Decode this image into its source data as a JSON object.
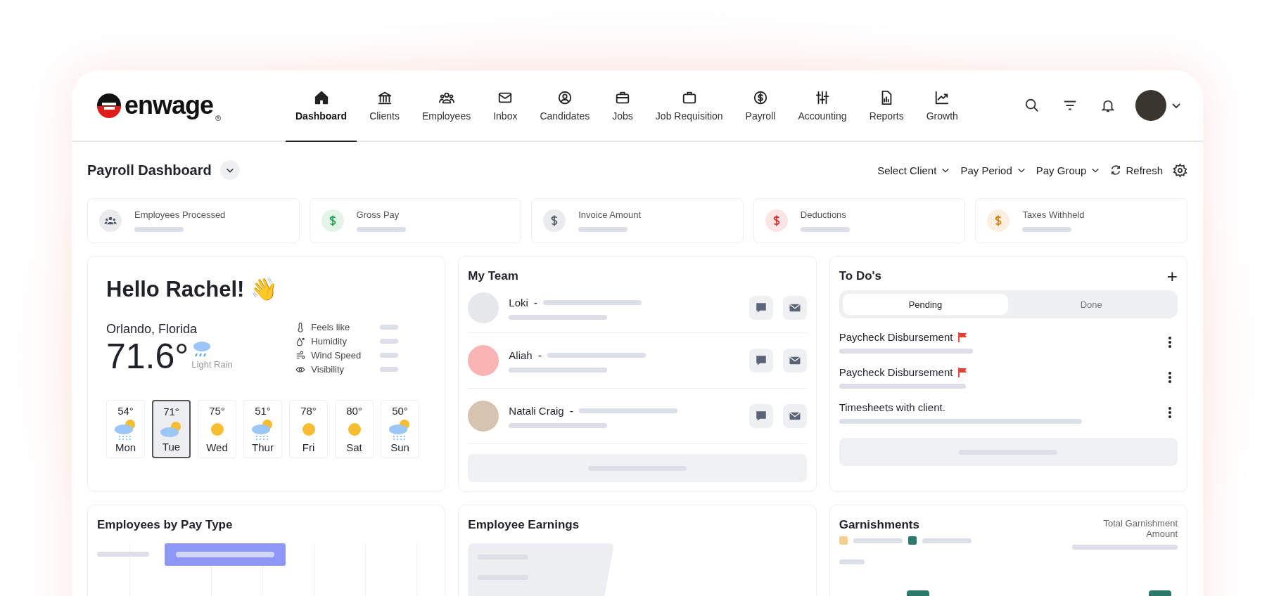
{
  "logo": {
    "text": "enwage",
    "mark": "®"
  },
  "nav": [
    {
      "label": "Dashboard",
      "selected": true
    },
    {
      "label": "Clients",
      "selected": false
    },
    {
      "label": "Employees",
      "selected": false
    },
    {
      "label": "Inbox",
      "selected": false
    },
    {
      "label": "Candidates",
      "selected": false
    },
    {
      "label": "Jobs",
      "selected": false
    },
    {
      "label": "Job Requisition",
      "selected": false
    },
    {
      "label": "Payroll",
      "selected": false
    },
    {
      "label": "Accounting",
      "selected": false
    },
    {
      "label": "Reports",
      "selected": false
    },
    {
      "label": "Growth",
      "selected": false
    }
  ],
  "page_title": "Payroll Dashboard",
  "filters": [
    "Select Client",
    "Pay Period",
    "Pay Group"
  ],
  "refresh": "Refresh",
  "kpis": [
    {
      "label": "Employees Processed",
      "kind": "people",
      "color": "#4b5563"
    },
    {
      "label": "Gross Pay",
      "kind": "dollar",
      "color": "#16a34a"
    },
    {
      "label": "Invoice Amount",
      "kind": "dollar",
      "color": "#4b5563"
    },
    {
      "label": "Deductions",
      "kind": "dollar",
      "color": "#dc2626"
    },
    {
      "label": "Taxes Withheld",
      "kind": "dollar",
      "color": "#d97706"
    }
  ],
  "weather": {
    "greeting": "Hello Rachel!",
    "emoji": "👋",
    "location": "Orlando, Florida",
    "temperature": "71.6°",
    "condition": "Light Rain",
    "details": [
      "Feels like",
      "Humidity",
      "Wind Speed",
      "Visibility"
    ],
    "forecast": [
      {
        "temp": "54°",
        "day": "Mon",
        "kind": "rain",
        "selected": false
      },
      {
        "temp": "71°",
        "day": "Tue",
        "kind": "cloudy",
        "selected": true
      },
      {
        "temp": "75°",
        "day": "Wed",
        "kind": "sunny",
        "selected": false
      },
      {
        "temp": "51°",
        "day": "Thur",
        "kind": "rain",
        "selected": false
      },
      {
        "temp": "78°",
        "day": "Fri",
        "kind": "sunny",
        "selected": false
      },
      {
        "temp": "80°",
        "day": "Sat",
        "kind": "sunny",
        "selected": false
      },
      {
        "temp": "50°",
        "day": "Sun",
        "kind": "rain",
        "selected": false
      }
    ]
  },
  "team": {
    "title": "My Team",
    "members": [
      {
        "name": "Loki",
        "separator": "-"
      },
      {
        "name": "Aliah",
        "separator": "-"
      },
      {
        "name": "Natali Craig",
        "separator": "-"
      }
    ]
  },
  "todos": {
    "title": "To Do's",
    "add": "+",
    "tabs": [
      {
        "label": "Pending",
        "selected": true
      },
      {
        "label": "Done",
        "selected": false
      }
    ],
    "items": [
      {
        "text": "Paycheck Disbursement",
        "flagged": true
      },
      {
        "text": "Paycheck Disbursement",
        "flagged": true
      },
      {
        "text": "Timesheets with client.",
        "flagged": false
      }
    ]
  },
  "pay_type": {
    "title": "Employees by Pay Type"
  },
  "earnings": {
    "title": "Employee Earnings"
  },
  "garnishments": {
    "title": "Garnishments",
    "total_label": "Total Garnishment Amount",
    "legend": [
      {
        "color": "#f8cf8c"
      },
      {
        "color": "#2b7a6b"
      }
    ]
  }
}
